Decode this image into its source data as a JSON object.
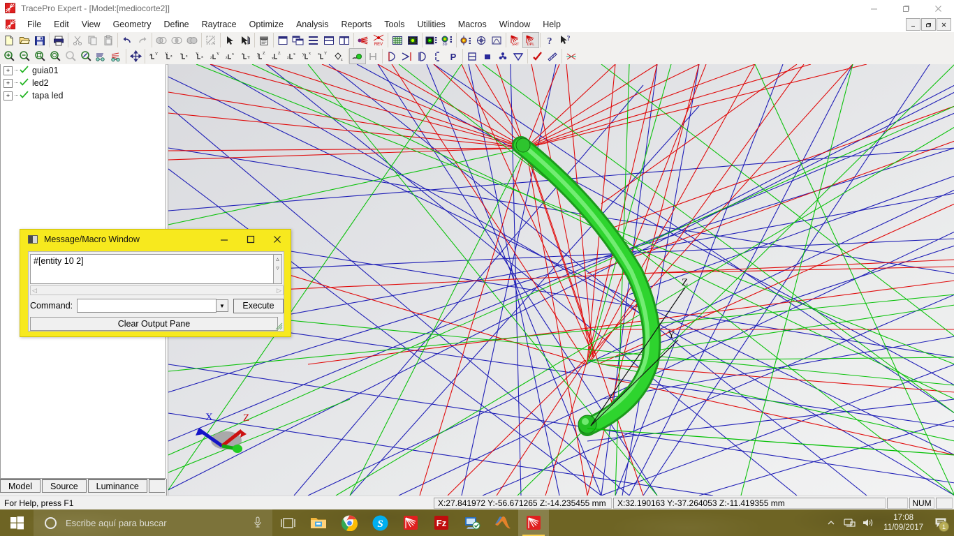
{
  "window": {
    "title": "TracePro Expert - [Model:[mediocorte2]]",
    "app_icon": "tracepro-icon",
    "controls": {
      "minimize": "–",
      "maximize": "❐",
      "close": "✕"
    }
  },
  "menubar": {
    "items": [
      {
        "label": "File"
      },
      {
        "label": "Edit"
      },
      {
        "label": "View"
      },
      {
        "label": "Geometry"
      },
      {
        "label": "Define"
      },
      {
        "label": "Raytrace"
      },
      {
        "label": "Optimize"
      },
      {
        "label": "Analysis"
      },
      {
        "label": "Reports"
      },
      {
        "label": "Tools"
      },
      {
        "label": "Utilities"
      },
      {
        "label": "Macros"
      },
      {
        "label": "Window"
      },
      {
        "label": "Help"
      }
    ],
    "mdi_controls": {
      "minimize": "–",
      "restore": "❐",
      "close": "✕"
    }
  },
  "toolbars": {
    "row1": [
      {
        "name": "new-file-icon",
        "glyph": "page"
      },
      {
        "name": "open-file-icon",
        "glyph": "folder"
      },
      {
        "name": "save-icon",
        "glyph": "floppy"
      },
      {
        "name": "print-icon",
        "glyph": "printer"
      },
      {
        "name": "cut-icon",
        "glyph": "scissors"
      },
      {
        "name": "copy-icon",
        "glyph": "copy"
      },
      {
        "name": "paste-icon",
        "glyph": "clipboard"
      },
      {
        "name": "undo-icon",
        "glyph": "undo"
      },
      {
        "name": "redo-icon",
        "glyph": "redo"
      },
      {
        "name": "boolean-subtract-icon",
        "glyph": "circles1"
      },
      {
        "name": "boolean-intersect-icon",
        "glyph": "circles2"
      },
      {
        "name": "boolean-union-icon",
        "glyph": "circles3"
      },
      {
        "name": "select-region-icon",
        "glyph": "marquee"
      },
      {
        "name": "select-arrow-icon",
        "glyph": "arrow"
      },
      {
        "name": "select-surface-icon",
        "glyph": "arrow-surf"
      },
      {
        "name": "property-list-icon",
        "glyph": "list"
      },
      {
        "name": "new-window-icon",
        "glyph": "window"
      },
      {
        "name": "tile-windows-icon",
        "glyph": "tile"
      },
      {
        "name": "cascade-icon",
        "glyph": "cascade"
      },
      {
        "name": "horizontal-split-icon",
        "glyph": "hsplit"
      },
      {
        "name": "vertical-split-icon",
        "glyph": "vsplit"
      },
      {
        "name": "raytrace-icon",
        "glyph": "rays"
      },
      {
        "name": "raytrace-reverse-icon",
        "glyph": "rays-rev"
      },
      {
        "name": "grid-icon",
        "glyph": "grid"
      },
      {
        "name": "irradiance-map-icon",
        "glyph": "irr-map"
      },
      {
        "name": "candela-plot-icon",
        "glyph": "candela"
      },
      {
        "name": "polar-3d-icon",
        "glyph": "polar3d"
      },
      {
        "name": "luminance-icon",
        "glyph": "lumin"
      },
      {
        "name": "incident-ray-icon",
        "glyph": "incident"
      },
      {
        "name": "histogram-icon",
        "glyph": "hist"
      },
      {
        "name": "srt-icon",
        "glyph": "srt",
        "label": "SRT"
      },
      {
        "name": "dpl-icon",
        "glyph": "dpl",
        "label": "DPL",
        "state": "active"
      },
      {
        "name": "help-icon",
        "glyph": "question"
      },
      {
        "name": "context-help-icon",
        "glyph": "arrow-question"
      }
    ],
    "row2": [
      {
        "name": "zoom-in-icon",
        "glyph": "zoom-plus"
      },
      {
        "name": "zoom-out-icon",
        "glyph": "zoom-minus"
      },
      {
        "name": "zoom-window-icon",
        "glyph": "zoom-box"
      },
      {
        "name": "zoom-all-icon",
        "glyph": "zoom-all"
      },
      {
        "name": "zoom-previous-icon",
        "glyph": "zoom-prev"
      },
      {
        "name": "zoom-selection-icon",
        "glyph": "zoom-sel"
      },
      {
        "name": "perspective-view-icon",
        "glyph": "persp1"
      },
      {
        "name": "orthographic-view-icon",
        "glyph": "persp2"
      },
      {
        "name": "pan-icon",
        "glyph": "pan"
      },
      {
        "name": "view-xy-icon",
        "glyph": "ax",
        "label": "xY"
      },
      {
        "name": "view-yz-icon",
        "glyph": "ax",
        "label": "Yz"
      },
      {
        "name": "view-xz-icon",
        "glyph": "ax",
        "label": "xz"
      },
      {
        "name": "view-yx-icon",
        "glyph": "ax",
        "label": "Yx"
      },
      {
        "name": "view-zy-icon",
        "glyph": "ax",
        "label": "zY"
      },
      {
        "name": "view-zx-icon",
        "glyph": "ax",
        "label": "zx"
      },
      {
        "name": "view-zy2-icon",
        "glyph": "ax",
        "label": "zY"
      },
      {
        "name": "view-yz2-icon",
        "glyph": "ax",
        "label": "yZ"
      },
      {
        "name": "view-xz2-icon",
        "glyph": "ax",
        "label": "xZ"
      },
      {
        "name": "view-zx2-icon",
        "glyph": "ax",
        "label": "zx"
      },
      {
        "name": "view-yx2-icon",
        "glyph": "ax",
        "label": "yx"
      },
      {
        "name": "view-xy2-icon",
        "glyph": "ax",
        "label": "xY"
      },
      {
        "name": "view-yz3-icon",
        "glyph": "ax",
        "label": "Yz"
      },
      {
        "name": "view-iso-icon",
        "glyph": "iso"
      },
      {
        "name": "shaded-model-icon",
        "glyph": "shaded",
        "state": "active"
      },
      {
        "name": "hidden-line-icon",
        "glyph": "hline"
      },
      {
        "name": "source-prop-icon",
        "glyph": "srcprop"
      },
      {
        "name": "ray-sort-icon",
        "glyph": "raysort"
      },
      {
        "name": "surface-source-icon",
        "glyph": "surfsrc"
      },
      {
        "name": "bracket-icon",
        "glyph": "bracket"
      },
      {
        "name": "property-icon",
        "glyph": "pletter",
        "label": "P"
      },
      {
        "name": "split-view-icon",
        "glyph": "splitv"
      },
      {
        "name": "filled-square-icon",
        "glyph": "fsquare"
      },
      {
        "name": "fan-icon",
        "glyph": "fan"
      },
      {
        "name": "cone-icon",
        "glyph": "cone"
      },
      {
        "name": "apply-check-icon",
        "glyph": "check"
      },
      {
        "name": "ruler-icon",
        "glyph": "ruler"
      },
      {
        "name": "ray-clip-icon",
        "glyph": "rayclip"
      }
    ]
  },
  "tree": {
    "items": [
      {
        "label": "guia01",
        "expander": "+",
        "checked": true
      },
      {
        "label": "led2",
        "expander": "+",
        "checked": true
      },
      {
        "label": "tapa led",
        "expander": "+",
        "checked": true
      }
    ]
  },
  "tabs": {
    "items": [
      {
        "label": "Model",
        "active": false
      },
      {
        "label": "Source",
        "active": true
      },
      {
        "label": "Luminance",
        "active": false
      }
    ]
  },
  "viewport": {
    "axis_labels": {
      "z": "Z",
      "y": "Y"
    },
    "triad_labels": {
      "x": "X",
      "z": "Z"
    },
    "ray_colors": {
      "red": "#e00000",
      "green": "#00c000",
      "blue": "#1414b4"
    },
    "model_color": "#28cc28"
  },
  "message_window": {
    "title": "Message/Macro Window",
    "icon": "message-window-icon",
    "controls": {
      "minimize": "–",
      "maximize": "☐",
      "close": "✕"
    },
    "output_text": "#[entity 10 2]",
    "command_label": "Command:",
    "command_value": "",
    "command_placeholder": "",
    "execute_label": "Execute",
    "clear_label": "Clear Output Pane",
    "title_bg": "#f7e91e"
  },
  "statusbar": {
    "help_text": "For Help, press F1",
    "coord1": "X:27.841972 Y:-56.671265 Z:-14.235455 mm",
    "coord2": "X:32.190163 Y:-37.264053 Z:-11.419355 mm",
    "indicator_blank": "",
    "num_lock": "NUM"
  },
  "taskbar": {
    "start": "start-button",
    "search_placeholder": "Escribe aquí para buscar",
    "cortana": "cortana-icon",
    "mic": "microphone-icon",
    "task_view": "task-view-icon",
    "pinned": [
      {
        "name": "file-explorer",
        "glyph": "explorer"
      },
      {
        "name": "google-chrome",
        "glyph": "chrome"
      },
      {
        "name": "skype",
        "glyph": "skype"
      },
      {
        "name": "tracepro",
        "glyph": "tracepro"
      },
      {
        "name": "filezilla",
        "glyph": "filezilla"
      },
      {
        "name": "remote-desktop",
        "glyph": "rdp"
      },
      {
        "name": "matlab",
        "glyph": "matlab"
      },
      {
        "name": "tracepro-active",
        "glyph": "tracepro",
        "active": true
      }
    ],
    "tray": {
      "show_hidden": "chevron-up-icon",
      "network": "network-icon",
      "volume": "volume-icon",
      "time": "17:08",
      "date": "11/09/2017",
      "notifications": "notification-icon",
      "notification_count": "1"
    }
  }
}
